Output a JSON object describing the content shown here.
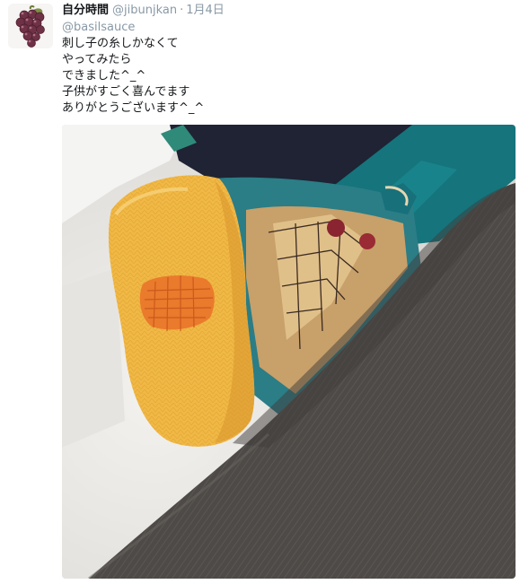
{
  "tweet": {
    "display_name": "自分時間",
    "handle": "@jibunjkan",
    "separator": "·",
    "timestamp": "1月4日",
    "mention": "@basilsauce",
    "lines": [
      "刺し子の糸しかなくて",
      "やってみたら",
      "できました^_^",
      "子供がすごく喜んでます",
      "ありがとうございます^_^"
    ]
  },
  "icons": {
    "avatar": "grapes-avatar-icon"
  },
  "media": {
    "description_icon": "photo-sock-darn",
    "colors": {
      "sock_yellow": "#f0b845",
      "darn_orange": "#ea7a2c",
      "pants_gray": "#4e4a47",
      "teal_sock": "#15747c"
    }
  }
}
